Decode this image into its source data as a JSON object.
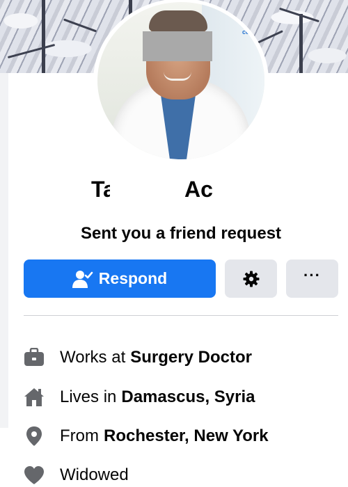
{
  "profile": {
    "name_first": "Ta",
    "name_last": "Ac",
    "request_text": "Sent you a friend request",
    "cover_photo": "snowy-branches",
    "avatar_logo": "coo",
    "avatar_photo": "man-in-white-coat"
  },
  "actions": {
    "respond_label": "Respond",
    "respond_icon": "person-check-icon",
    "gear_icon": "gear-icon",
    "more_label": "···",
    "more_icon": "more-icon"
  },
  "details": [
    {
      "icon": "briefcase-icon",
      "prefix": "Works at",
      "value": "Surgery Doctor"
    },
    {
      "icon": "home-icon",
      "prefix": "Lives in",
      "value": "Damascus, Syria"
    },
    {
      "icon": "location-pin-icon",
      "prefix": "From",
      "value": "Rochester, New York"
    },
    {
      "icon": "heart-icon",
      "prefix": "Widowed",
      "value": ""
    }
  ],
  "colors": {
    "primary": "#1877f2",
    "secondary_button": "#e4e6eb",
    "icon_gray": "#65676b",
    "text": "#050505"
  }
}
